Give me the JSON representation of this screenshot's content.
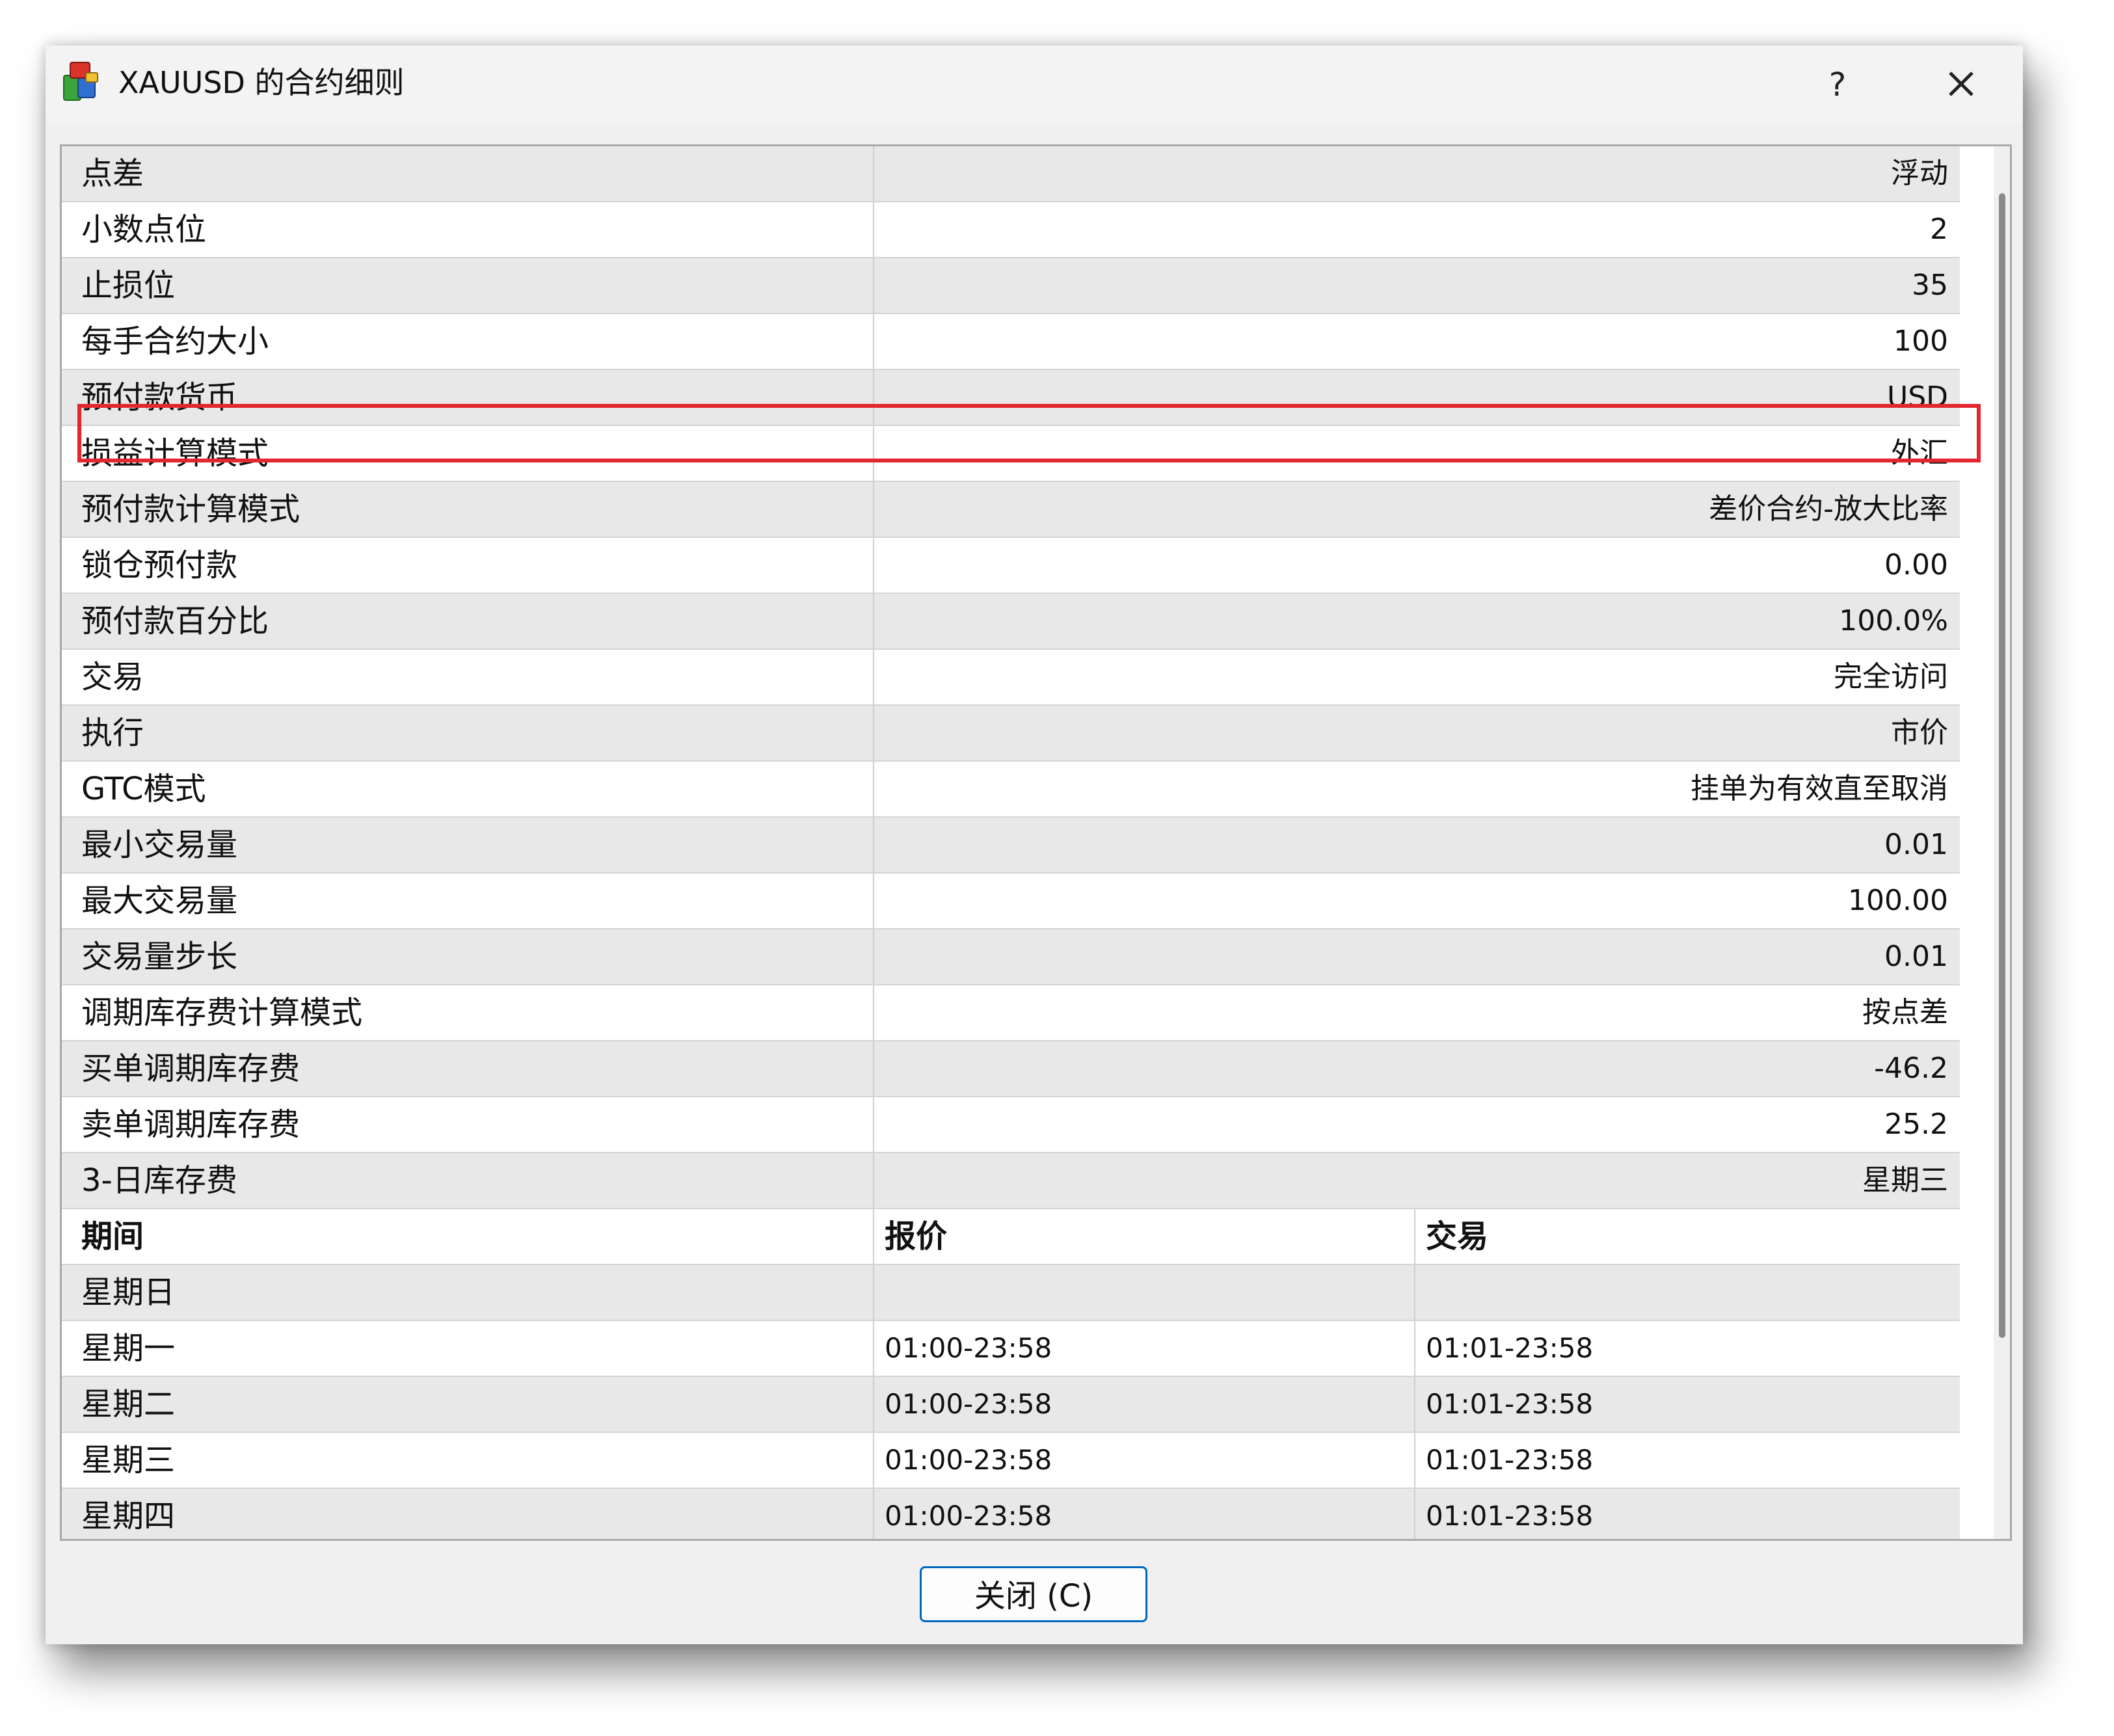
{
  "window": {
    "title": "XAUUSD 的合约细则",
    "help_label": "?",
    "app_icon": "app-icon",
    "close_icon": "close-icon"
  },
  "specs": [
    {
      "name": "点差",
      "value": "浮动"
    },
    {
      "name": "小数点位",
      "value": "2"
    },
    {
      "name": "止损位",
      "value": "35"
    },
    {
      "name": "每手合约大小",
      "value": "100"
    },
    {
      "name": "预付款货币",
      "value": "USD"
    },
    {
      "name": "损益计算模式",
      "value": "外汇"
    },
    {
      "name": "预付款计算模式",
      "value": "差价合约-放大比率"
    },
    {
      "name": "锁仓预付款",
      "value": "0.00"
    },
    {
      "name": "预付款百分比",
      "value": "100.0%"
    },
    {
      "name": "交易",
      "value": "完全访问"
    },
    {
      "name": "执行",
      "value": "市价"
    },
    {
      "name": "GTC模式",
      "value": "挂单为有效直至取消"
    },
    {
      "name": "最小交易量",
      "value": "0.01"
    },
    {
      "name": "最大交易量",
      "value": "100.00"
    },
    {
      "name": "交易量步长",
      "value": "0.01"
    },
    {
      "name": "调期库存费计算模式",
      "value": "按点差"
    },
    {
      "name": "买单调期库存费",
      "value": "-46.2"
    },
    {
      "name": "卖单调期库存费",
      "value": "25.2"
    },
    {
      "name": "3-日库存费",
      "value": "星期三"
    }
  ],
  "sessions": {
    "headers": [
      "期间",
      "报价",
      "交易"
    ],
    "rows": [
      {
        "day": "星期日",
        "quote": "",
        "trade": ""
      },
      {
        "day": "星期一",
        "quote": "01:00-23:58",
        "trade": "01:01-23:58"
      },
      {
        "day": "星期二",
        "quote": "01:00-23:58",
        "trade": "01:01-23:58"
      },
      {
        "day": "星期三",
        "quote": "01:00-23:58",
        "trade": "01:01-23:58"
      },
      {
        "day": "星期四",
        "quote": "01:00-23:58",
        "trade": "01:01-23:58"
      }
    ]
  },
  "footer": {
    "close_label": "关闭 (C)"
  },
  "colors": {
    "highlight_border": "#e3262f",
    "button_border": "#0067c0",
    "alt_row": "#e8e8e8"
  }
}
